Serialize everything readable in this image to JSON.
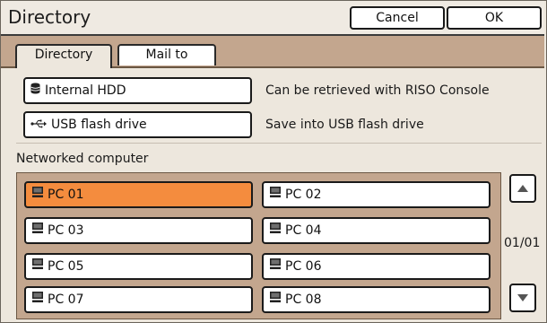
{
  "window": {
    "title": "Directory",
    "cancel_label": "Cancel",
    "ok_label": "OK"
  },
  "tabs": [
    {
      "label": "Directory",
      "active": true
    },
    {
      "label": "Mail to",
      "active": false
    }
  ],
  "sources": [
    {
      "label": "Internal HDD",
      "icon": "hdd-icon",
      "description": "Can be retrieved with RISO Console"
    },
    {
      "label": "USB flash drive",
      "icon": "usb-icon",
      "description": "Save into USB flash drive"
    }
  ],
  "networked": {
    "title": "Networked computer",
    "computers": [
      {
        "label": "PC 01",
        "selected": true
      },
      {
        "label": "PC 02",
        "selected": false
      },
      {
        "label": "PC 03",
        "selected": false
      },
      {
        "label": "PC 04",
        "selected": false
      },
      {
        "label": "PC 05",
        "selected": false
      },
      {
        "label": "PC 06",
        "selected": false
      },
      {
        "label": "PC 07",
        "selected": false
      },
      {
        "label": "PC 08",
        "selected": false
      }
    ],
    "page_indicator": "01/01"
  },
  "colors": {
    "selected": "#f48c3e",
    "tabstrip": "#c3a68e",
    "background": "#ede7dd"
  }
}
